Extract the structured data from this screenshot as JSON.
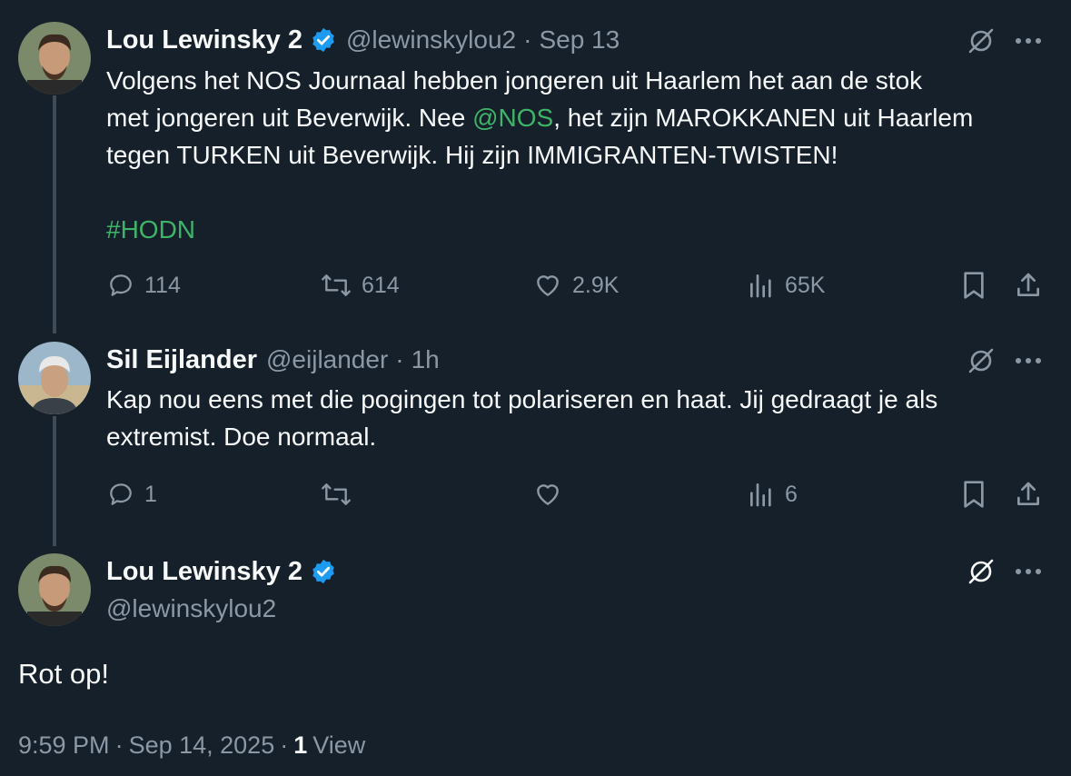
{
  "tweet1": {
    "author": "Lou Lewinsky 2",
    "handle": "@lewinskylou2",
    "date": "Sep 13",
    "text_part1": "Volgens het NOS Journaal hebben jongeren uit Haarlem het aan de stok",
    "text_part2": "met jongeren uit Beverwijk. Nee ",
    "mention": "@NOS",
    "text_part3": ", het zijn MAROKKANEN uit Haarlem",
    "text_part4": "tegen TURKEN uit Beverwijk.  Hij zijn IMMIGRANTEN-TWISTEN!",
    "hashtag": "#HODN",
    "replies": "114",
    "reposts": "614",
    "likes": "2.9K",
    "views": "65K"
  },
  "tweet2": {
    "author": "Sil Eijlander",
    "handle": "@eijlander",
    "date": "1h",
    "text_line1": "Kap nou eens met die pogingen tot polariseren en haat. Jij gedraagt je als",
    "text_line2": "extremist. Doe normaal.",
    "replies": "1",
    "views": "6"
  },
  "tweet3": {
    "author": "Lou Lewinsky 2",
    "handle": "@lewinskylou2",
    "text": "Rot op!",
    "time": "9:59 PM",
    "date": "Sep 14, 2025",
    "view_count": "1",
    "view_label": "View"
  },
  "separator": "·",
  "colors": {
    "background": "#15202b",
    "text": "#f7f9f9",
    "muted": "#8b98a5",
    "verified": "#1d9bf0",
    "hashtag": "#3fb468"
  }
}
